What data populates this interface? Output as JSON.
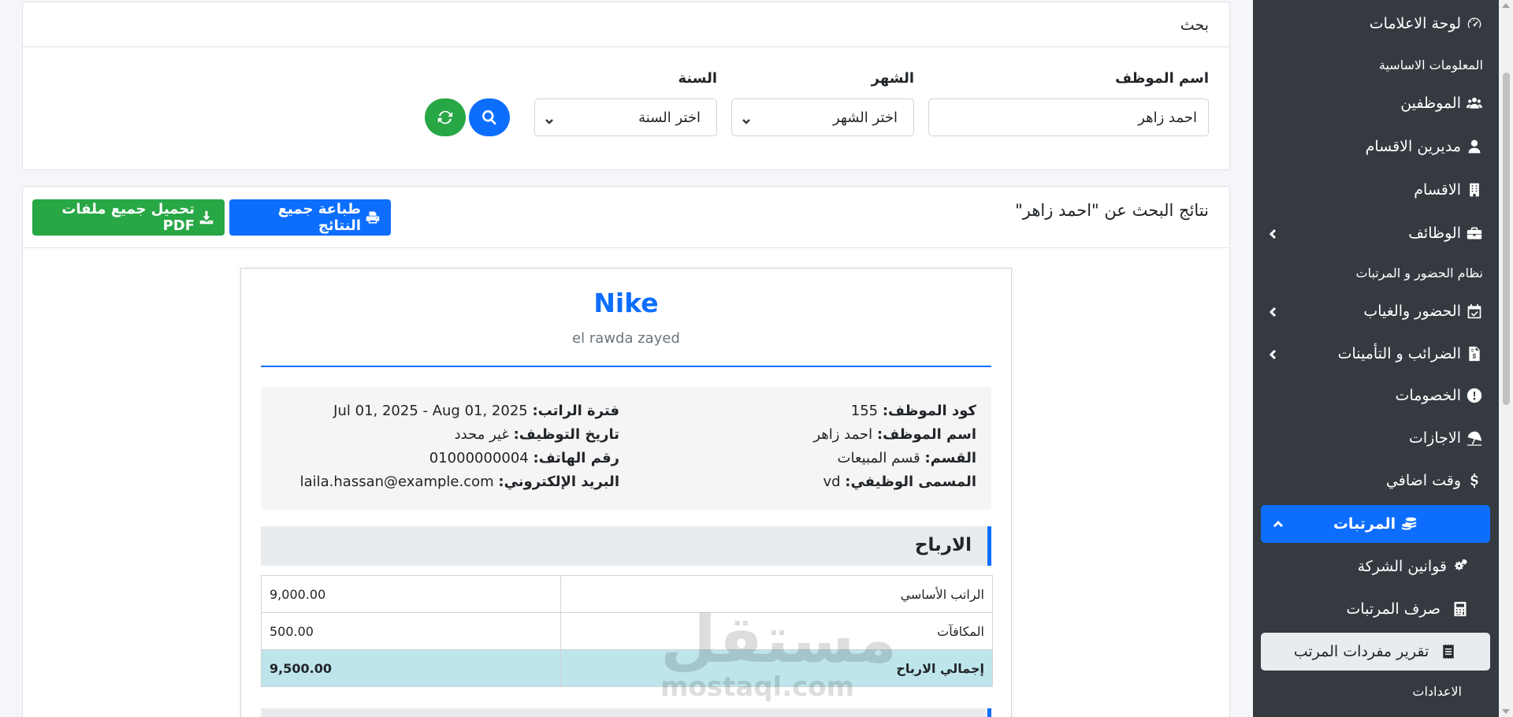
{
  "sidebar": {
    "items": [
      {
        "label": "لوحة الاعلامات",
        "icon": "dashboard-icon"
      },
      {
        "label": "المعلومات الاساسية",
        "type": "section"
      },
      {
        "label": "الموظفين",
        "icon": "users-icon"
      },
      {
        "label": "مديرين الاقسام",
        "icon": "user-icon"
      },
      {
        "label": "الاقسام",
        "icon": "building-icon"
      },
      {
        "label": "الوظائف",
        "icon": "briefcase-icon",
        "has_children": true
      },
      {
        "label": "نظام الحضور و المرتبات",
        "type": "section"
      },
      {
        "label": "الحضور والغياب",
        "icon": "calendar-check-icon",
        "has_children": true
      },
      {
        "label": "الضرائب و التأمينات",
        "icon": "file-invoice-icon",
        "has_children": true
      },
      {
        "label": "الخصومات",
        "icon": "exclamation-circle-icon"
      },
      {
        "label": "الاجازات",
        "icon": "umbrella-beach-icon"
      },
      {
        "label": "وقت اضافي",
        "icon": "dollar-icon"
      },
      {
        "label": "المرتبات",
        "icon": "coins-icon",
        "active": true,
        "expanded": true
      },
      {
        "label": "قوانين الشركة",
        "icon": "cogs-icon"
      },
      {
        "label": "صرف المرتبات",
        "icon": "calculator-icon"
      },
      {
        "label": "تقرير مفردات المرتب",
        "icon": "receipt-icon",
        "current": true
      },
      {
        "label": "الاعدادات",
        "type": "section"
      }
    ]
  },
  "search": {
    "title": "بحث",
    "employee_label": "اسم الموظف",
    "employee_value": "احمد زاهر",
    "month_label": "الشهر",
    "month_value": "اختر الشهر",
    "year_label": "السنة",
    "year_value": "اختر السنة"
  },
  "results": {
    "title": "نتائج البحث عن \"احمد زاهر\"",
    "print_label": "طباعة جميع النتائج",
    "download_label": "تحميل جميع ملفات PDF"
  },
  "payslip": {
    "company": "Nike",
    "address": "el rawda zayed",
    "employee_code_label": "كود الموظف:",
    "employee_code": "155",
    "employee_name_label": "اسم الموظف:",
    "employee_name": "احمد زاهر",
    "department_label": "القسم:",
    "department": "قسم المبيعات",
    "job_title_label": "المسمى الوظيفي:",
    "job_title": "vd",
    "period_label": "فترة الراتب:",
    "period": "Jul 01, 2025 - Aug 01, 2025",
    "hire_date_label": "تاريخ التوظيف:",
    "hire_date": "غير محدد",
    "phone_label": "رقم الهاتف:",
    "phone": "01000000004",
    "email_label": "البريد الإلكتروني:",
    "email": "laila.hassan@example.com",
    "earnings_title": "الارباح",
    "earnings": [
      {
        "label": "الراتب الأساسي",
        "value": "9,000.00"
      },
      {
        "label": "المكافآت",
        "value": "500.00"
      }
    ],
    "earnings_total_label": "إجمالي الارباح",
    "earnings_total": "9,500.00"
  },
  "watermark": {
    "arabic": "مستقل",
    "english": "mostaql.com"
  },
  "colors": {
    "primary": "#0d6efd",
    "success": "#28a745",
    "sidebar": "#343a40",
    "total_row": "#bee5eb"
  }
}
